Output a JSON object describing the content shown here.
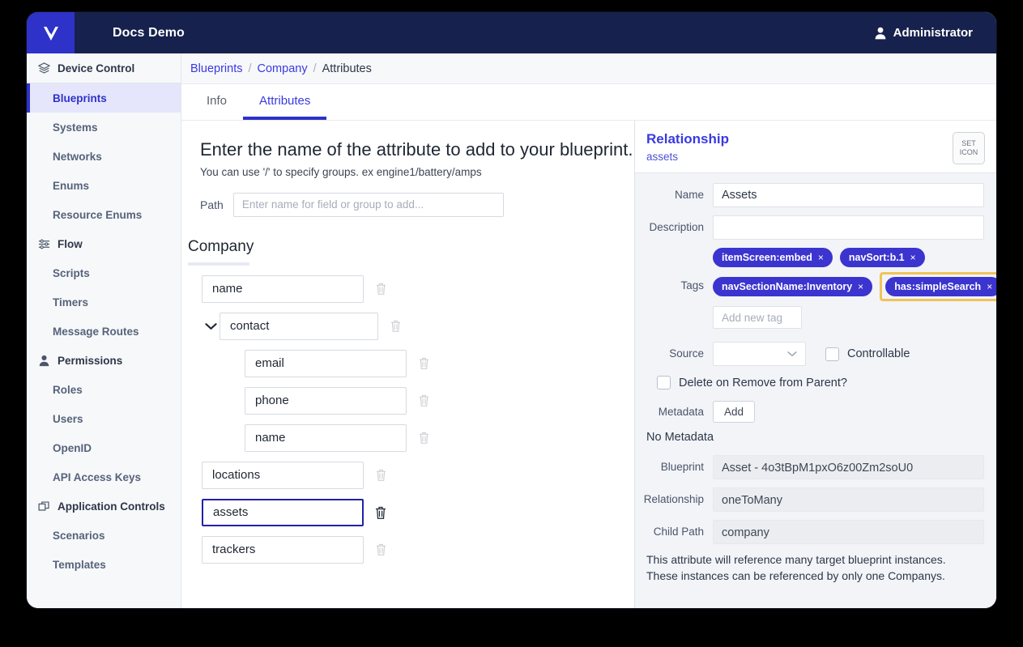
{
  "topbar": {
    "logo_icon": "chevron-v-logo-icon",
    "app_title": "Docs Demo",
    "user_icon": "user-icon",
    "user_name": "Administrator"
  },
  "sidebar": {
    "groups": [
      {
        "icon": "layers-icon",
        "label": "Device Control",
        "items": [
          {
            "label": "Blueprints",
            "active": true
          },
          {
            "label": "Systems",
            "active": false
          },
          {
            "label": "Networks",
            "active": false
          },
          {
            "label": "Enums",
            "active": false
          },
          {
            "label": "Resource Enums",
            "active": false
          }
        ]
      },
      {
        "icon": "sliders-icon",
        "label": "Flow",
        "items": [
          {
            "label": "Scripts",
            "active": false
          },
          {
            "label": "Timers",
            "active": false
          },
          {
            "label": "Message Routes",
            "active": false
          }
        ]
      },
      {
        "icon": "person-icon",
        "label": "Permissions",
        "items": [
          {
            "label": "Roles",
            "active": false
          },
          {
            "label": "Users",
            "active": false
          },
          {
            "label": "OpenID",
            "active": false
          },
          {
            "label": "API Access Keys",
            "active": false
          }
        ]
      },
      {
        "icon": "windows-icon",
        "label": "Application Controls",
        "items": [
          {
            "label": "Scenarios",
            "active": false
          },
          {
            "label": "Templates",
            "active": false
          }
        ]
      }
    ]
  },
  "breadcrumb": {
    "items": [
      "Blueprints",
      "Company",
      "Attributes"
    ],
    "separator": "/"
  },
  "tabs": [
    {
      "label": "Info",
      "active": false
    },
    {
      "label": "Attributes",
      "active": true
    }
  ],
  "left_pane": {
    "heading": "Enter the name of the attribute to add to your blueprint.",
    "subheading": "You can use '/' to specify groups. ex engine1/battery/amps",
    "path_label": "Path",
    "path_value": "",
    "path_placeholder": "Enter name for field or group to add...",
    "group_title": "Company",
    "fields": [
      {
        "value": "name",
        "level": 0,
        "caret": false,
        "selected": false,
        "trash_active": false
      },
      {
        "value": "contact",
        "level": 0,
        "caret": true,
        "selected": false,
        "trash_active": false
      },
      {
        "value": "email",
        "level": 1,
        "caret": false,
        "selected": false,
        "trash_active": false
      },
      {
        "value": "phone",
        "level": 1,
        "caret": false,
        "selected": false,
        "trash_active": false
      },
      {
        "value": "name",
        "level": 1,
        "caret": false,
        "selected": false,
        "trash_active": false
      },
      {
        "value": "locations",
        "level": 0,
        "caret": false,
        "selected": false,
        "trash_active": false
      },
      {
        "value": "assets",
        "level": 0,
        "caret": false,
        "selected": true,
        "trash_active": true
      },
      {
        "value": "trackers",
        "level": 0,
        "caret": false,
        "selected": false,
        "trash_active": false
      }
    ]
  },
  "right_pane": {
    "title": "Relationship",
    "subtitle": "assets",
    "set_icon_line1": "SET",
    "set_icon_line2": "ICON",
    "name_label": "Name",
    "name_value": "Assets",
    "description_label": "Description",
    "description_value": "",
    "tags_label": "Tags",
    "tags_row1": [
      {
        "text": "itemScreen:embed",
        "close": "×",
        "highlighted": false
      },
      {
        "text": "navSort:b.1",
        "close": "×",
        "highlighted": false
      }
    ],
    "tags_row2": [
      {
        "text": "navSectionName:Inventory",
        "close": "×",
        "highlighted": false
      },
      {
        "text": "has:simpleSearch",
        "close": "×",
        "highlighted": true
      }
    ],
    "add_tag_placeholder": "Add new tag",
    "add_tag_value": "",
    "source_label": "Source",
    "source_value": "",
    "controllable_label": "Controllable",
    "controllable_checked": false,
    "delete_on_remove_label": "Delete on Remove from Parent?",
    "delete_on_remove_checked": false,
    "metadata_label": "Metadata",
    "metadata_add_label": "Add",
    "no_metadata_text": "No Metadata",
    "blueprint_label": "Blueprint",
    "blueprint_value": "Asset - 4o3tBpM1pxO6z00Zm2soU0",
    "relationship_label": "Relationship",
    "relationship_value": "oneToMany",
    "child_path_label": "Child Path",
    "child_path_value": "company",
    "note_line1": "This attribute will reference many target blueprint instances.",
    "note_line2": "These instances can be referenced by only one Companys."
  },
  "colors": {
    "topbar_bg": "#16214d",
    "logo_bg": "#2e32c8",
    "accent": "#2e32c8",
    "link": "#3a3ae0",
    "tag_bg": "#3b34cf",
    "highlight_border": "#f0c45a",
    "sidebar_bg": "#f7f8fa",
    "right_pane_bg": "#f2f4f8",
    "selected_field_border": "#2222a8"
  }
}
